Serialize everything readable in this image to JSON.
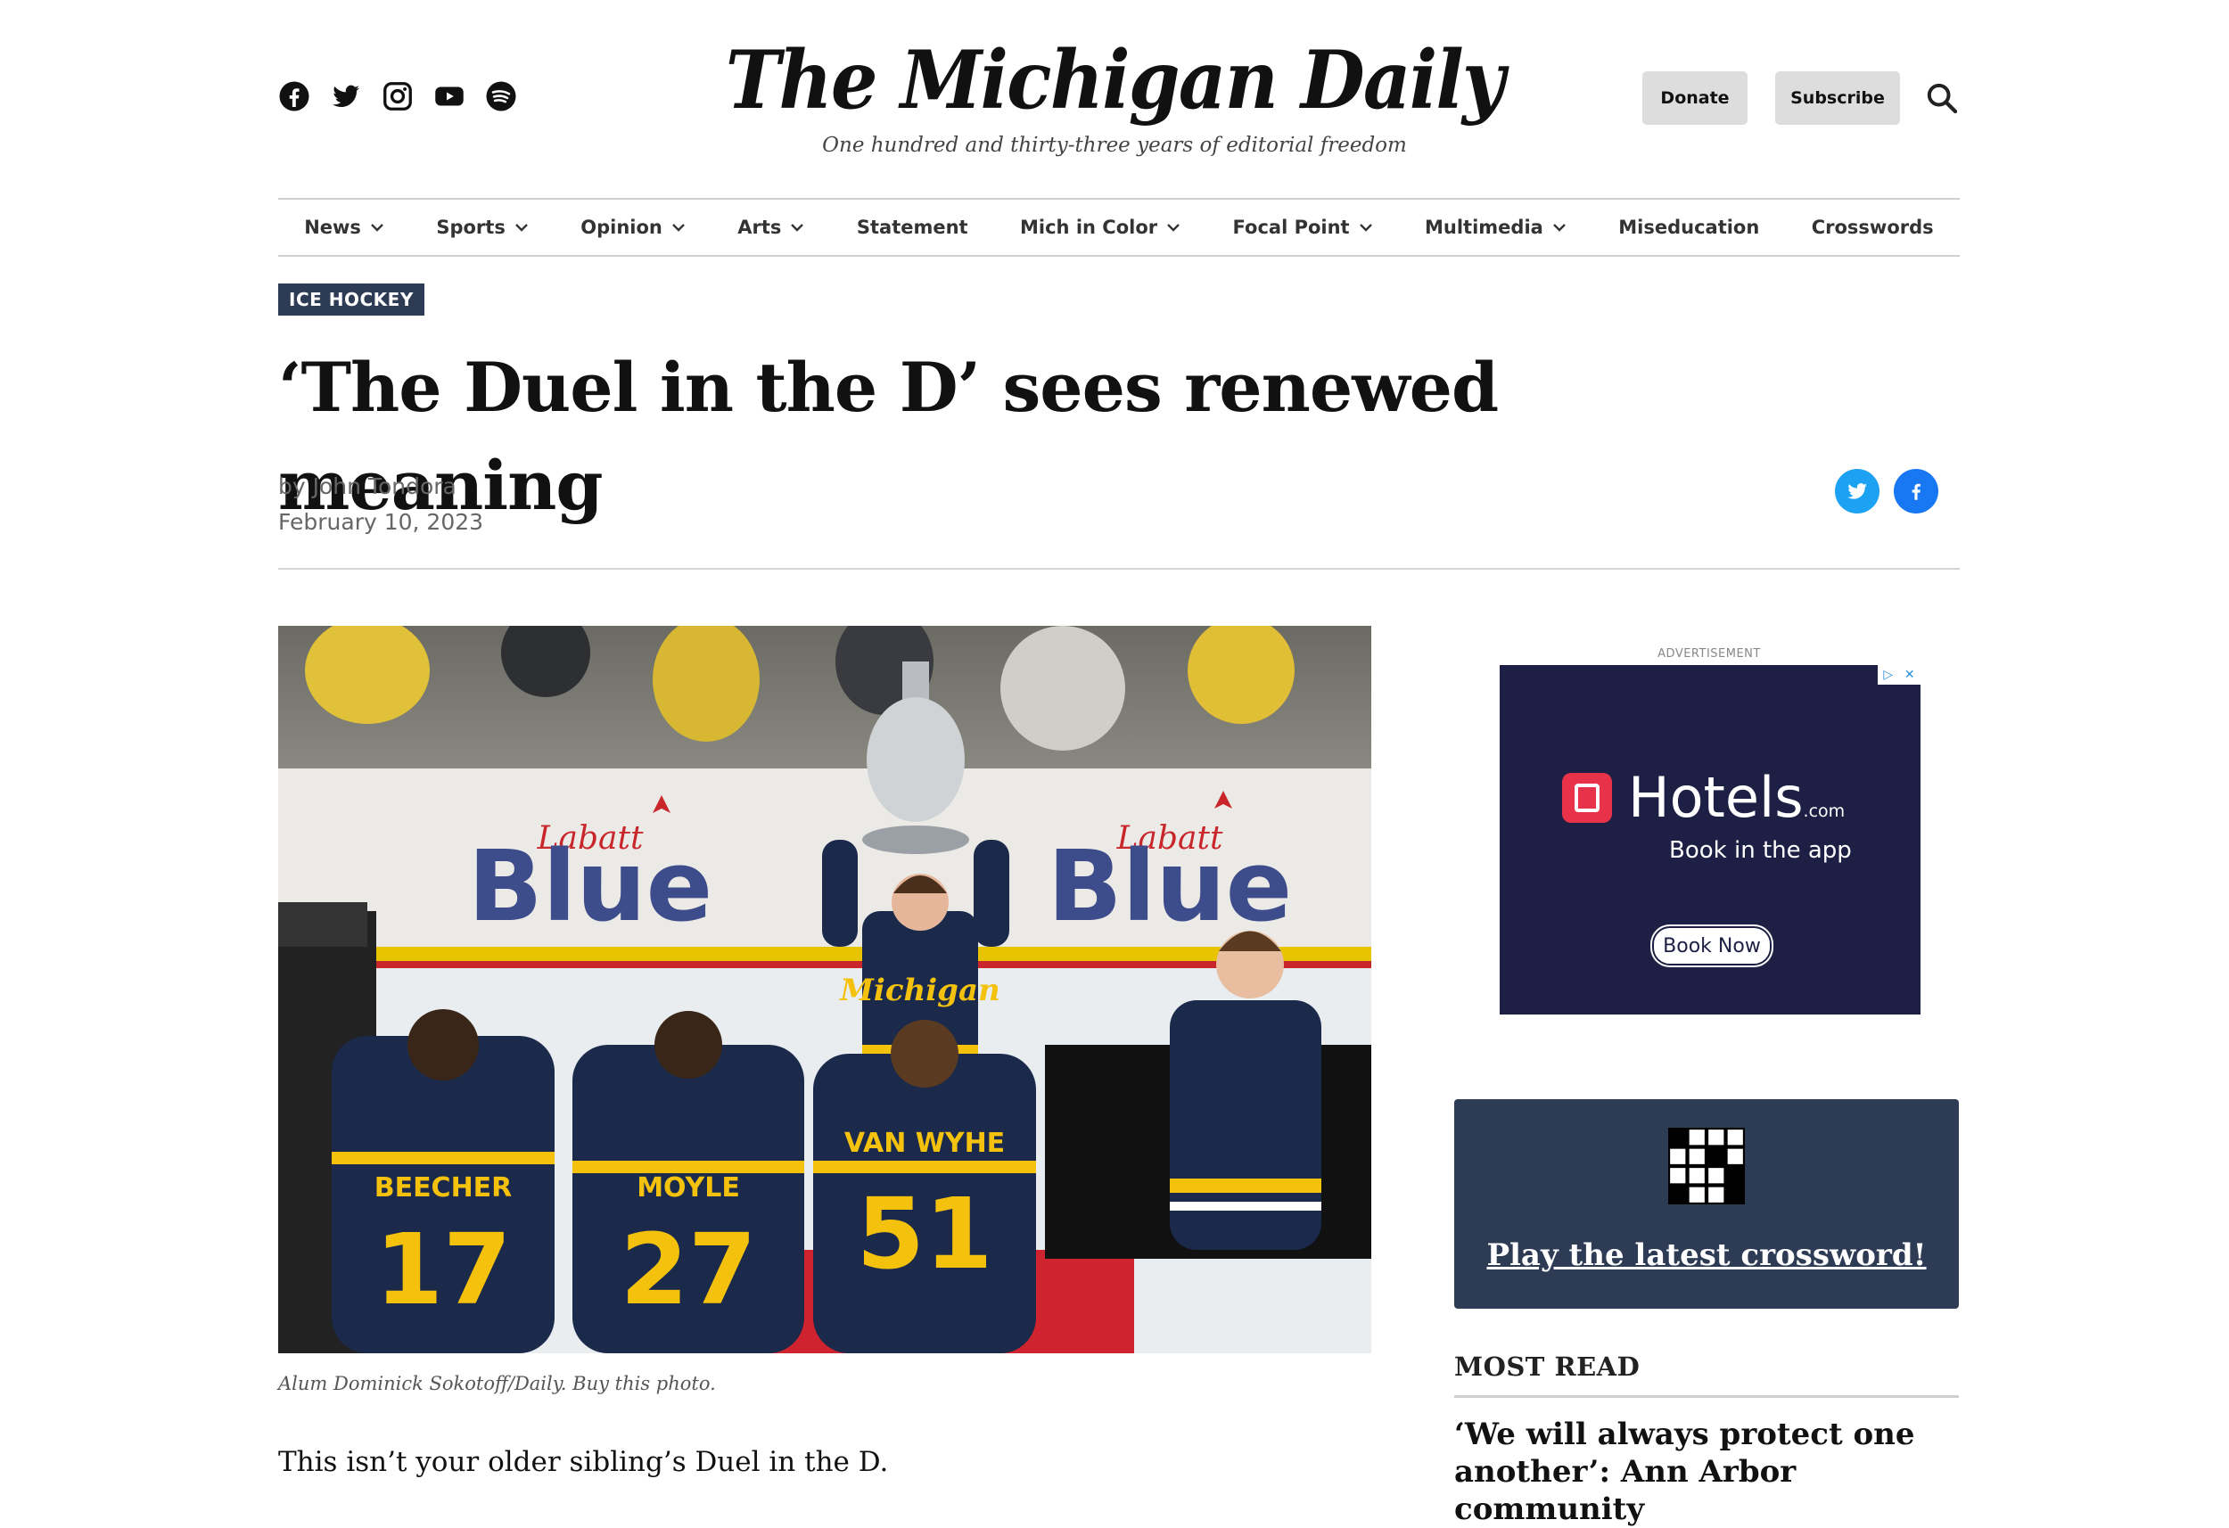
{
  "header": {
    "social": [
      "facebook-icon",
      "twitter-icon",
      "instagram-icon",
      "youtube-icon",
      "spotify-icon"
    ],
    "masthead": "The Michigan Daily",
    "tagline": "One hundred and thirty-three years of editorial freedom",
    "donate_label": "Donate",
    "subscribe_label": "Subscribe"
  },
  "nav": {
    "items": [
      {
        "label": "News",
        "dropdown": true
      },
      {
        "label": "Sports",
        "dropdown": true
      },
      {
        "label": "Opinion",
        "dropdown": true
      },
      {
        "label": "Arts",
        "dropdown": true
      },
      {
        "label": "Statement",
        "dropdown": false
      },
      {
        "label": "Mich in Color",
        "dropdown": true
      },
      {
        "label": "Focal Point",
        "dropdown": true
      },
      {
        "label": "Multimedia",
        "dropdown": true
      },
      {
        "label": "Miseducation",
        "dropdown": false
      },
      {
        "label": "Crosswords",
        "dropdown": false
      }
    ]
  },
  "article": {
    "category": "ICE HOCKEY",
    "headline": "‘The Duel in the D’ sees renewed meaning",
    "byline_prefix": "by ",
    "author": "John Tondora",
    "date": "February 10, 2023",
    "photo": {
      "board_word": "Blue",
      "board_brand": "Labatt",
      "jerseys": [
        {
          "name": "BEECHER",
          "number": "17"
        },
        {
          "name": "MOYLE",
          "number": "27"
        },
        {
          "name": "VAN WYHE",
          "number": "51"
        }
      ],
      "jersey_script": "Michigan"
    },
    "caption": "Alum Dominick Sokotoff/Daily. Buy this photo.",
    "lede": "This isn’t your older sibling’s Duel in the D."
  },
  "sidebar": {
    "ad_label": "ADVERTISEMENT",
    "ad": {
      "brand": "Hotels",
      "brand_suffix": ".com",
      "tagline": "Book in the app",
      "cta": "Book Now"
    },
    "crossword_link": "Play the latest crossword!",
    "most_read_heading": "MOST READ",
    "most_read_first": "‘We will always protect one another’: Ann Arbor community"
  },
  "colors": {
    "kicker_bg": "#2e3b55",
    "ad_bg": "#1d1f44",
    "twitter": "#1da1f2",
    "facebook": "#1877f2",
    "michigan_navy": "#1b2a4a",
    "maize": "#f4c20d"
  }
}
